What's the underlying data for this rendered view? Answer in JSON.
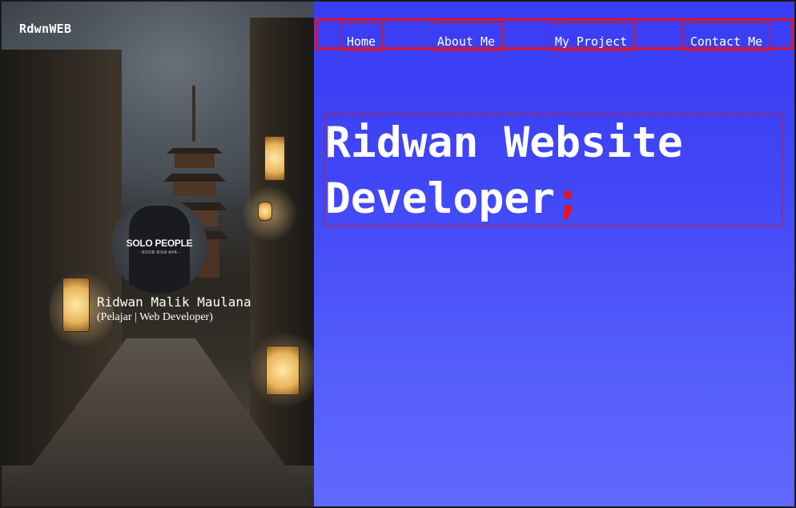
{
  "sidebar": {
    "brand": "RdwnWEB",
    "avatar_shirt_text": "SOLO PEOPLE",
    "avatar_shirt_sub": "- NOOB BISA APA -",
    "profile_name": "Ridwan Malik Maulana",
    "profile_role": "(Pelajar | Web Developer)"
  },
  "nav": {
    "items": [
      {
        "label": "Home"
      },
      {
        "label": "About Me"
      },
      {
        "label": "My Project"
      },
      {
        "label": "Contact Me"
      }
    ]
  },
  "hero": {
    "line1": "Ridwan Website",
    "line2": "Developer",
    "accent": ";"
  },
  "colors": {
    "accent": "#ee1111",
    "panel_blue": "#3a3cf4",
    "text": "#ffffff"
  }
}
